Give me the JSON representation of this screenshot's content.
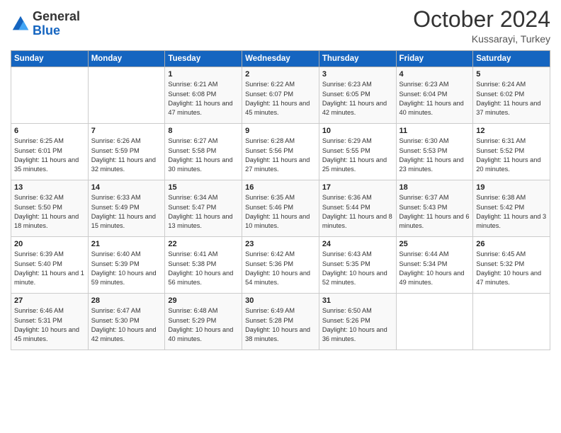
{
  "header": {
    "logo_general": "General",
    "logo_blue": "Blue",
    "month": "October 2024",
    "location": "Kussarayi, Turkey"
  },
  "days_of_week": [
    "Sunday",
    "Monday",
    "Tuesday",
    "Wednesday",
    "Thursday",
    "Friday",
    "Saturday"
  ],
  "weeks": [
    [
      {
        "day": "",
        "info": ""
      },
      {
        "day": "",
        "info": ""
      },
      {
        "day": "1",
        "info": "Sunrise: 6:21 AM\nSunset: 6:08 PM\nDaylight: 11 hours and 47 minutes."
      },
      {
        "day": "2",
        "info": "Sunrise: 6:22 AM\nSunset: 6:07 PM\nDaylight: 11 hours and 45 minutes."
      },
      {
        "day": "3",
        "info": "Sunrise: 6:23 AM\nSunset: 6:05 PM\nDaylight: 11 hours and 42 minutes."
      },
      {
        "day": "4",
        "info": "Sunrise: 6:23 AM\nSunset: 6:04 PM\nDaylight: 11 hours and 40 minutes."
      },
      {
        "day": "5",
        "info": "Sunrise: 6:24 AM\nSunset: 6:02 PM\nDaylight: 11 hours and 37 minutes."
      }
    ],
    [
      {
        "day": "6",
        "info": "Sunrise: 6:25 AM\nSunset: 6:01 PM\nDaylight: 11 hours and 35 minutes."
      },
      {
        "day": "7",
        "info": "Sunrise: 6:26 AM\nSunset: 5:59 PM\nDaylight: 11 hours and 32 minutes."
      },
      {
        "day": "8",
        "info": "Sunrise: 6:27 AM\nSunset: 5:58 PM\nDaylight: 11 hours and 30 minutes."
      },
      {
        "day": "9",
        "info": "Sunrise: 6:28 AM\nSunset: 5:56 PM\nDaylight: 11 hours and 27 minutes."
      },
      {
        "day": "10",
        "info": "Sunrise: 6:29 AM\nSunset: 5:55 PM\nDaylight: 11 hours and 25 minutes."
      },
      {
        "day": "11",
        "info": "Sunrise: 6:30 AM\nSunset: 5:53 PM\nDaylight: 11 hours and 23 minutes."
      },
      {
        "day": "12",
        "info": "Sunrise: 6:31 AM\nSunset: 5:52 PM\nDaylight: 11 hours and 20 minutes."
      }
    ],
    [
      {
        "day": "13",
        "info": "Sunrise: 6:32 AM\nSunset: 5:50 PM\nDaylight: 11 hours and 18 minutes."
      },
      {
        "day": "14",
        "info": "Sunrise: 6:33 AM\nSunset: 5:49 PM\nDaylight: 11 hours and 15 minutes."
      },
      {
        "day": "15",
        "info": "Sunrise: 6:34 AM\nSunset: 5:47 PM\nDaylight: 11 hours and 13 minutes."
      },
      {
        "day": "16",
        "info": "Sunrise: 6:35 AM\nSunset: 5:46 PM\nDaylight: 11 hours and 10 minutes."
      },
      {
        "day": "17",
        "info": "Sunrise: 6:36 AM\nSunset: 5:44 PM\nDaylight: 11 hours and 8 minutes."
      },
      {
        "day": "18",
        "info": "Sunrise: 6:37 AM\nSunset: 5:43 PM\nDaylight: 11 hours and 6 minutes."
      },
      {
        "day": "19",
        "info": "Sunrise: 6:38 AM\nSunset: 5:42 PM\nDaylight: 11 hours and 3 minutes."
      }
    ],
    [
      {
        "day": "20",
        "info": "Sunrise: 6:39 AM\nSunset: 5:40 PM\nDaylight: 11 hours and 1 minute."
      },
      {
        "day": "21",
        "info": "Sunrise: 6:40 AM\nSunset: 5:39 PM\nDaylight: 10 hours and 59 minutes."
      },
      {
        "day": "22",
        "info": "Sunrise: 6:41 AM\nSunset: 5:38 PM\nDaylight: 10 hours and 56 minutes."
      },
      {
        "day": "23",
        "info": "Sunrise: 6:42 AM\nSunset: 5:36 PM\nDaylight: 10 hours and 54 minutes."
      },
      {
        "day": "24",
        "info": "Sunrise: 6:43 AM\nSunset: 5:35 PM\nDaylight: 10 hours and 52 minutes."
      },
      {
        "day": "25",
        "info": "Sunrise: 6:44 AM\nSunset: 5:34 PM\nDaylight: 10 hours and 49 minutes."
      },
      {
        "day": "26",
        "info": "Sunrise: 6:45 AM\nSunset: 5:32 PM\nDaylight: 10 hours and 47 minutes."
      }
    ],
    [
      {
        "day": "27",
        "info": "Sunrise: 6:46 AM\nSunset: 5:31 PM\nDaylight: 10 hours and 45 minutes."
      },
      {
        "day": "28",
        "info": "Sunrise: 6:47 AM\nSunset: 5:30 PM\nDaylight: 10 hours and 42 minutes."
      },
      {
        "day": "29",
        "info": "Sunrise: 6:48 AM\nSunset: 5:29 PM\nDaylight: 10 hours and 40 minutes."
      },
      {
        "day": "30",
        "info": "Sunrise: 6:49 AM\nSunset: 5:28 PM\nDaylight: 10 hours and 38 minutes."
      },
      {
        "day": "31",
        "info": "Sunrise: 6:50 AM\nSunset: 5:26 PM\nDaylight: 10 hours and 36 minutes."
      },
      {
        "day": "",
        "info": ""
      },
      {
        "day": "",
        "info": ""
      }
    ]
  ]
}
